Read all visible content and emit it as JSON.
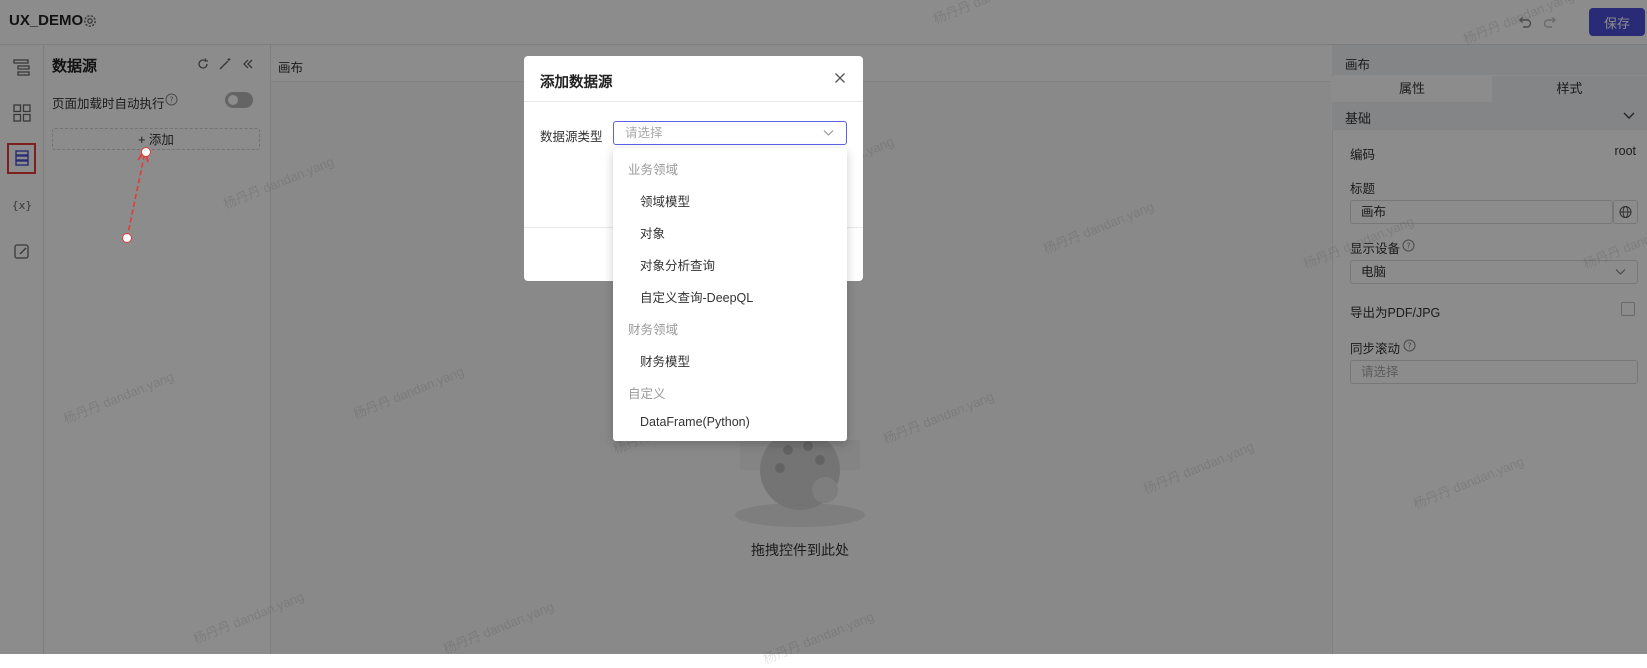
{
  "header": {
    "app_title": "UX_DEMO",
    "save_label": "保存"
  },
  "datasource_panel": {
    "title": "数据源",
    "auto_exec_label": "页面加载时自动执行",
    "add_label": "+ 添加"
  },
  "canvas": {
    "label": "画布",
    "empty_text": "拖拽控件到此处"
  },
  "right_panel": {
    "title": "画布",
    "tabs": [
      "属性",
      "样式"
    ],
    "section": "基础",
    "code_label": "编码",
    "code_value": "root",
    "title_label": "标题",
    "title_value": "画布",
    "device_label": "显示设备",
    "device_value": "电脑",
    "export_label": "导出为PDF/JPG",
    "sync_label": "同步滚动",
    "sync_placeholder": "请选择"
  },
  "modal": {
    "title": "添加数据源",
    "type_label": "数据源类型",
    "type_placeholder": "请选择",
    "groups": [
      {
        "label": "业务领域",
        "items": [
          "领域模型",
          "对象",
          "对象分析查询",
          "自定义查询-DeepQL"
        ]
      },
      {
        "label": "财务领域",
        "items": [
          "财务模型"
        ]
      },
      {
        "label": "自定义",
        "items": [
          "DataFrame(Python)"
        ]
      }
    ]
  },
  "watermark": "杨丹丹 dandan.yang",
  "colors": {
    "accent": "#4b4fd8",
    "annotation_red": "#e53935"
  }
}
